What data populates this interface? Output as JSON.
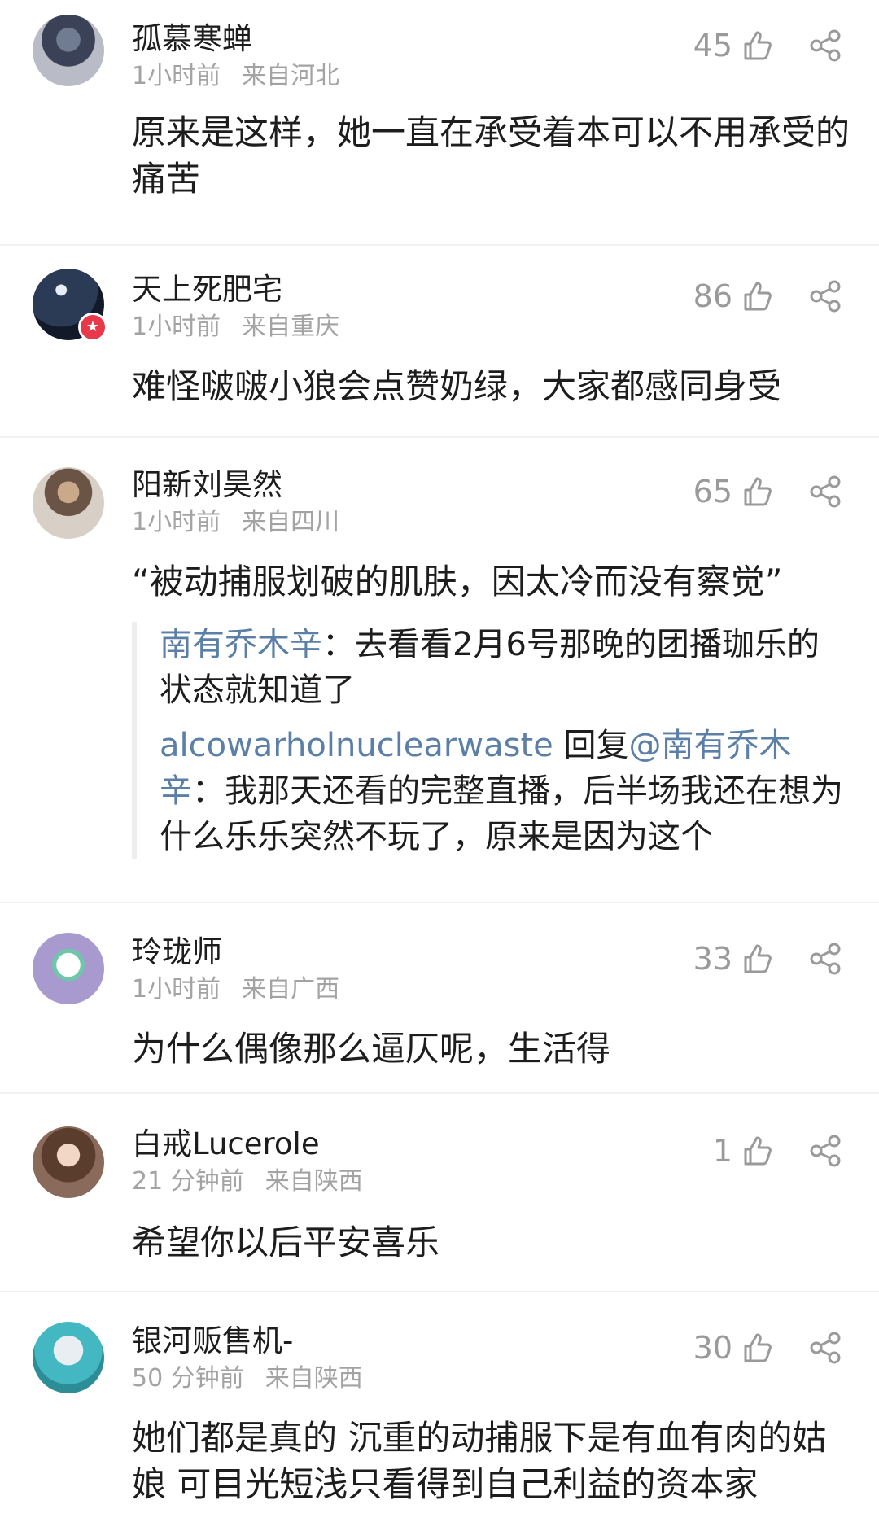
{
  "comments": [
    {
      "username": "孤慕寒蝉",
      "time": "1小时前",
      "location": "来自河北",
      "likes": "45",
      "text": "原来是这样，她一直在承受着本可以不用承受的痛苦"
    },
    {
      "username": "天上死肥宅",
      "time": "1小时前",
      "location": "来自重庆",
      "likes": "86",
      "text": "难怪啵啵小狼会点赞奶绿，大家都感同身受"
    },
    {
      "username": "阳新刘昊然",
      "time": "1小时前",
      "location": "来自四川",
      "likes": "65",
      "text": "“被动捕服划破的肌肤，因太冷而没有察觉”",
      "replies": [
        {
          "name": "南有乔木辛",
          "sep": "：",
          "text": "去看看2月6号那晚的团播珈乐的状态就知道了"
        },
        {
          "name": "alcowarholnuclearwaste",
          "reply_word": " 回复",
          "reply_to": "@南有乔木辛",
          "sep": "：",
          "text": "我那天还看的完整直播，后半场我还在想为什么乐乐突然不玩了，原来是因为这个"
        }
      ]
    },
    {
      "username": "玲珑师",
      "time": "1小时前",
      "location": "来自广西",
      "likes": "33",
      "text": "为什么偶像那么逼仄呢，生活得"
    },
    {
      "username": "白戒Lucerole",
      "time": "21 分钟前",
      "location": "来自陕西",
      "likes": "1",
      "text": "希望你以后平安喜乐"
    },
    {
      "username": "银河贩售机-",
      "time": "50 分钟前",
      "location": "来自陕西",
      "likes": "30",
      "text": "她们都是真的 沉重的动捕服下是有血有肉的姑娘 可目光短浅只看得到自己利益的资本家"
    }
  ],
  "icons": {
    "like": "thumbs-up-icon",
    "share": "share-icon"
  },
  "colors": {
    "reply_name": "#5b7fa6",
    "meta": "#a3a3a3",
    "badge": "#e8394a"
  }
}
